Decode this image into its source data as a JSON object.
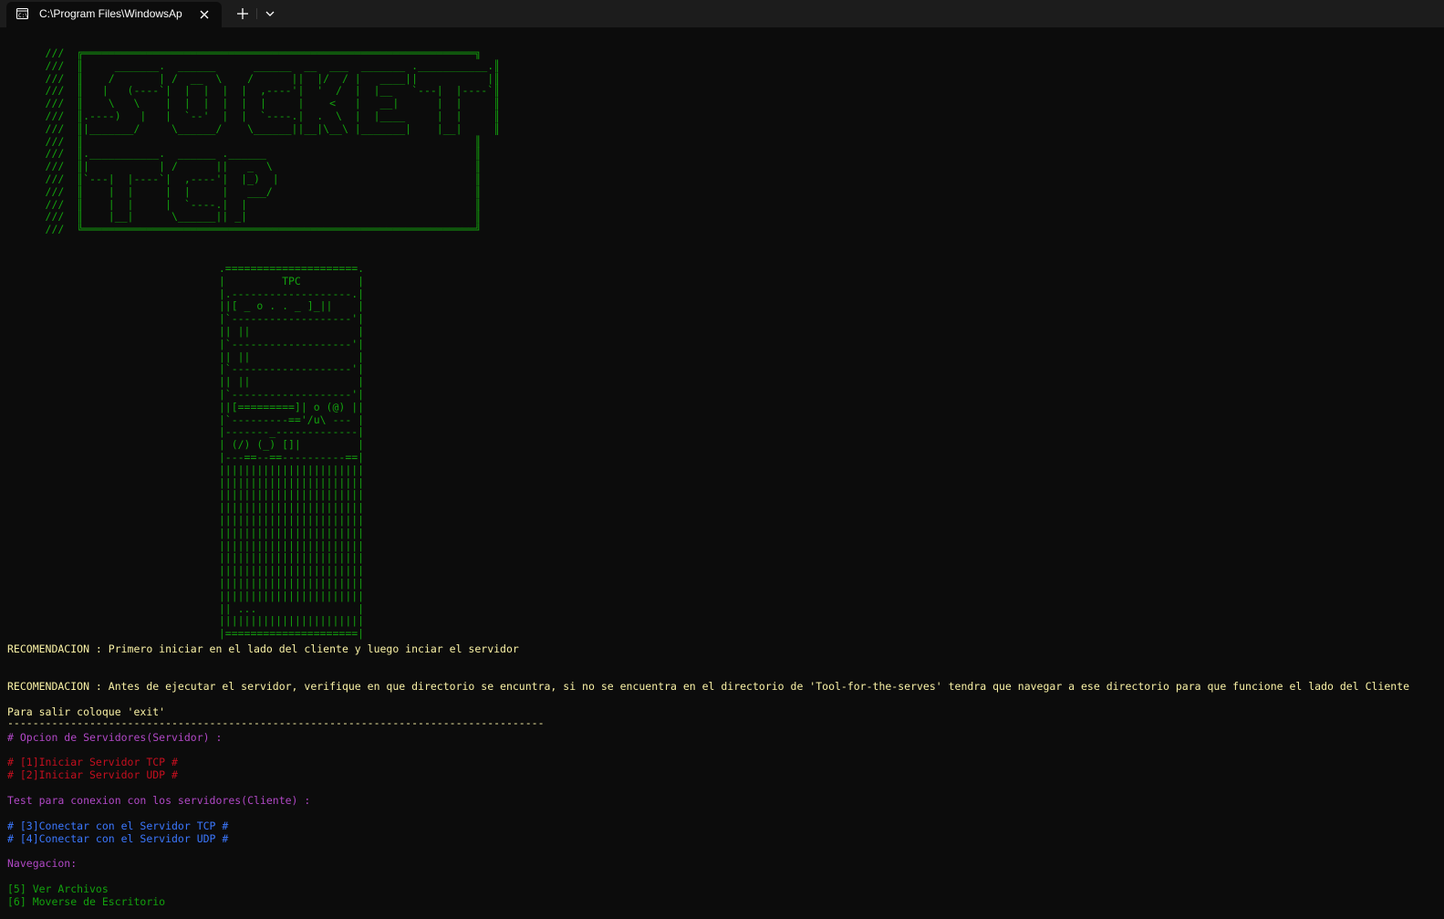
{
  "window": {
    "tab_title": "C:\\Program Files\\WindowsAp",
    "tab_icon": "terminal-icon",
    "close_icon": "close-icon",
    "new_tab_icon": "plus-icon",
    "dropdown_icon": "chevron-down-icon"
  },
  "colors": {
    "background": "#0c0c0c",
    "ascii_green": "#13a10e",
    "yellow": "#f9f1a5",
    "purple": "#b148c6",
    "red": "#c50f1f",
    "blue": "#3b78ff"
  },
  "ascii": {
    "banner": "      ///  ╔══════════════════════════════════════════════════════════════╗\n      ///  ║     _______.  ______      ______  __  ___  _______ .___________.║\n      ///  ║    /       | /  __  \\    /      ||  |/  / |   ____||           |║\n      ///  ║   |   (----`|  |  |  |  |  ,----'|  '  /  |  |__   `---|  |----`║\n      ///  ║    \\   \\    |  |  |  |  |  |     |    <   |   __|      |  |     ║\n      ///  ║.----)   |   |  `--'  |  |  `----.|  .  \\  |  |____     |  |     ║\n      ///  ║|_______/     \\______/    \\______||__|\\__\\ |_______|    |__|     ║\n      ///  ║                                                              ║\n      ///  ║.___________.  ______ .______                                 ║\n      ///  ║|           | /      ||   _  \\                                ║\n      ///  ║`---|  |----`|  ,----'|  |_)  |                               ║\n      ///  ║    |  |     |  |     |   ___/                                ║\n      ///  ║    |  |     |  `----.|  |                                    ║\n      ///  ║    |__|      \\______|| _|                                    ║\n      ///  ╚══════════════════════════════════════════════════════════════╝",
    "computer": "  .=====================.\n  |         TPC         |\n  |.-------------------.|\n  ||[ _ o . . _ ]_||    |\n  |`-------------------'|\n  || ||                 |\n  |`-------------------'|\n  || ||                 |\n  |`-------------------'|\n  || ||                 |\n  |`-------------------'|\n  ||[=========]| o (@) ||\n  |`---------=='/u\\ --- |\n  |-------_-------------|\n  | (/) (_) []|         |\n  |---==--==----------==|\n  |||||||||||||||||||||||\n  |||||||||||||||||||||||\n  |||||||||||||||||||||||\n  |||||||||||||||||||||||\n  |||||||||||||||||||||||\n  |||||||||||||||||||||||\n  |||||||||||||||||||||||\n  |||||||||||||||||||||||\n  |||||||||||||||||||||||\n  |||||||||||||||||||||||\n  |||||||||||||||||||||||\n  || ...                |\n  |||||||||||||||||||||||\n  |=====================|"
  },
  "messages": {
    "recomendacion_1": "RECOMENDACION : Primero iniciar en el lado del cliente y luego inciar el servidor",
    "recomendacion_2": "RECOMENDACION : Antes de ejecutar el servidor, verifique en que directorio se encuntra, si no se encuentra en el directorio de 'Tool-for-the-serves' tendra que navegar a ese directorio para que funcione el lado del Cliente",
    "exit_hint": "Para salir coloque 'exit'",
    "divider": "-------------------------------------------------------------------------------------"
  },
  "menu": {
    "servers_heading": "# Opcion de Servidores(Servidor) :",
    "opt1": "# [1]Iniciar Servidor TCP #",
    "opt2": "# [2]Iniciar Servidor UDP #",
    "test_heading": "Test para conexion con los servidores(Cliente) :",
    "opt3": "# [3]Conectar con el Servidor TCP #",
    "opt4": "# [4]Conectar con el Servidor UDP #",
    "nav_heading": "Navegacion:",
    "opt5": "[5] Ver Archivos",
    "opt6": "[6] Moverse de Escritorio"
  }
}
